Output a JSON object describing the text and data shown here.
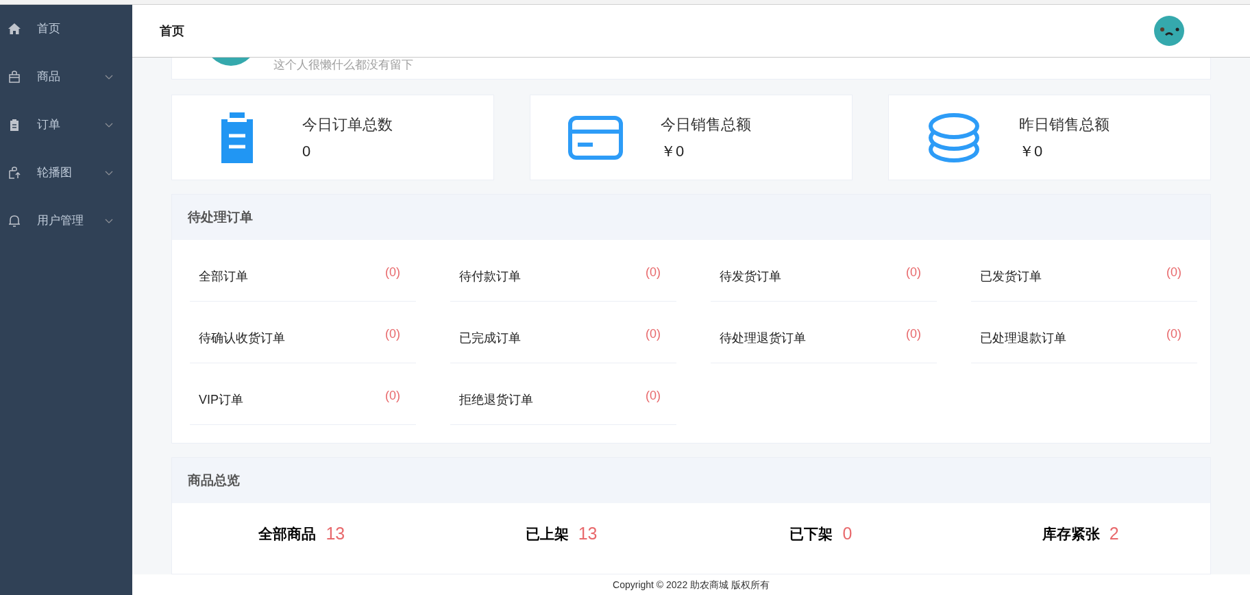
{
  "sidebar": {
    "items": [
      {
        "label": "首页",
        "expandable": false
      },
      {
        "label": "商品",
        "expandable": true
      },
      {
        "label": "订单",
        "expandable": true
      },
      {
        "label": "轮播图",
        "expandable": true
      },
      {
        "label": "用户管理",
        "expandable": true
      }
    ]
  },
  "header": {
    "title": "首页"
  },
  "profile": {
    "bio": "这个人很懒什么都没有留下"
  },
  "stats": [
    {
      "label": "今日订单总数",
      "value": "0"
    },
    {
      "label": "今日销售总额",
      "value": "￥0"
    },
    {
      "label": "昨日销售总额",
      "value": "￥0"
    }
  ],
  "pending_orders": {
    "title": "待处理订单",
    "items": [
      {
        "label": "全部订单",
        "count": "(0)"
      },
      {
        "label": "待付款订单",
        "count": "(0)"
      },
      {
        "label": "待发货订单",
        "count": "(0)"
      },
      {
        "label": "已发货订单",
        "count": "(0)"
      },
      {
        "label": "待确认收货订单",
        "count": "(0)"
      },
      {
        "label": "已完成订单",
        "count": "(0)"
      },
      {
        "label": "待处理退货订单",
        "count": "(0)"
      },
      {
        "label": "已处理退款订单",
        "count": "(0)"
      },
      {
        "label": "VIP订单",
        "count": "(0)"
      },
      {
        "label": "拒绝退货订单",
        "count": "(0)"
      }
    ]
  },
  "product_overview": {
    "title": "商品总览",
    "items": [
      {
        "label": "全部商品",
        "value": "13"
      },
      {
        "label": "已上架",
        "value": "13"
      },
      {
        "label": "已下架",
        "value": "0"
      },
      {
        "label": "库存紧张",
        "value": "2"
      }
    ]
  },
  "footer": {
    "copyright": "Copyright © 2022 助农商城 版权所有"
  }
}
